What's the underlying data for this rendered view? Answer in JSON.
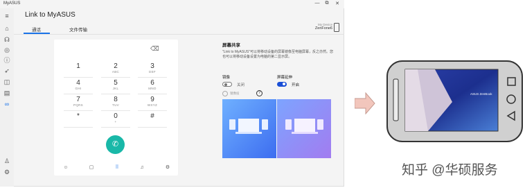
{
  "app": {
    "title": "MyASUS",
    "window_controls": [
      "—",
      "⧉",
      "✕"
    ],
    "header_title": "Link to MyASUS",
    "tabs": [
      {
        "label": "通话",
        "active": true
      },
      {
        "label": "文件传输",
        "active": false
      }
    ],
    "device": {
      "label": "My Device",
      "name": "ZenFone6"
    },
    "accent_color": "#1a73e8"
  },
  "sidebar": {
    "items": [
      {
        "icon": "home-icon"
      },
      {
        "icon": "headset-icon"
      },
      {
        "icon": "diagnosis-icon"
      },
      {
        "icon": "info-icon"
      },
      {
        "icon": "rocket-icon"
      },
      {
        "icon": "bag-icon"
      },
      {
        "icon": "news-icon"
      },
      {
        "icon": "link-icon",
        "active": true
      }
    ],
    "bottom_items": [
      {
        "icon": "user-icon"
      },
      {
        "icon": "settings-icon"
      }
    ]
  },
  "dialer": {
    "keys": [
      {
        "digit": "1",
        "letters": ""
      },
      {
        "digit": "2",
        "letters": "ABC"
      },
      {
        "digit": "3",
        "letters": "DEF"
      },
      {
        "digit": "4",
        "letters": "GHI"
      },
      {
        "digit": "5",
        "letters": "JKL"
      },
      {
        "digit": "6",
        "letters": "MNO"
      },
      {
        "digit": "7",
        "letters": "PQRS"
      },
      {
        "digit": "8",
        "letters": "TUV"
      },
      {
        "digit": "9",
        "letters": "WXYZ"
      },
      {
        "digit": "*",
        "letters": ""
      },
      {
        "digit": "0",
        "letters": "+"
      },
      {
        "digit": "#",
        "letters": ""
      }
    ],
    "call_color": "#19b8a8",
    "bottom_icons": [
      "contacts-icon",
      "square-icon",
      "dialpad-icon",
      "bell-icon",
      "settings-icon"
    ]
  },
  "screen_share": {
    "title": "屏幕共享",
    "description": "\"Link to MyASUS\"可以将移动设备的屏幕镜像至电脑屏幕，反之亦然。您也可以将移动设备设置为电脑的第二显示屏。",
    "mirror": {
      "label": "镜像",
      "state_text": "关闭",
      "on": false
    },
    "extend": {
      "label": "屏幕延伸",
      "state_text": "开启",
      "on": true
    },
    "radio_label": "镜像投",
    "help": "?",
    "toggle_on_color": "#1a4fd6"
  },
  "watermark": "知乎 @华硕服务",
  "phone": {
    "screen_text": "ASUS ZenBook"
  }
}
